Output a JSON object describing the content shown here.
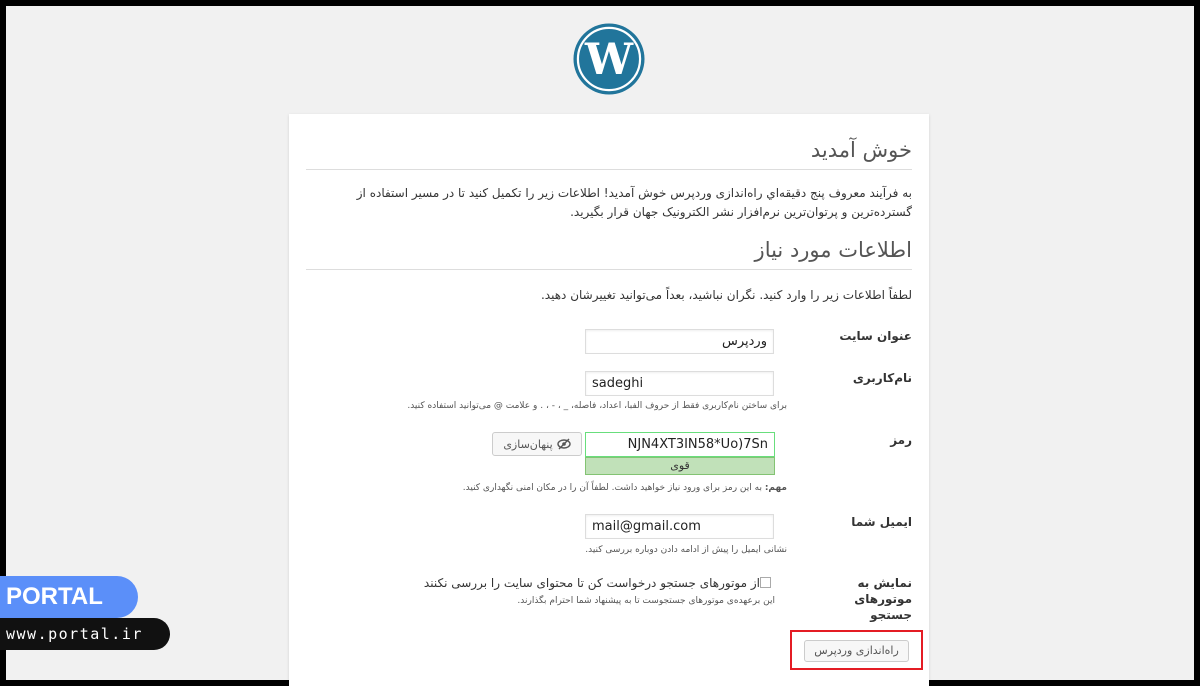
{
  "brand": {
    "logo_icon": "wordpress-logo-icon",
    "logo_color": "#21759b"
  },
  "welcome": {
    "title": "خوش آمدید",
    "intro": "به فرآیند معروف پنج دقیقه‌اي راه‌اندازی وردپرس خوش آمدید! اطلاعات زیر را تکمیل کنید تا در مسیر استفاده از گسترده‌ترین و پرتوان‌ترین نرم‌افزار نشر الکترونیک جهان قرار بگیرید."
  },
  "info": {
    "title": "اطلاعات مورد نیاز",
    "instructions": "لطفاً اطلاعات زیر را وارد کنید. نگران نباشید، بعداً می‌توانید تغییرشان دهید."
  },
  "form": {
    "site_title": {
      "label": "عنوان سایت",
      "value": "وردپرس"
    },
    "username": {
      "label": "نام‌کاربری",
      "value": "sadeghi",
      "hint": "برای ساختن نام‌کاربری فقط از حروف الفبا، اعداد، فاصله، _ ، - ، . و علامت @ می‌توانید استفاده کنید."
    },
    "password": {
      "label": "رمز",
      "value": "NJN4XT3IN58*Uo)7Sn",
      "strength": "قوی",
      "hide_label": "پنهان‌سازی",
      "hide_icon": "eye-slash-icon",
      "note_bold": "مهم:",
      "note": " به این رمز برای ورود نیاز خواهید داشت. لطفاً آن را در مکان امنی نگهداری کنید."
    },
    "email": {
      "label": "ایمیل شما",
      "value": "mail@gmail.com",
      "hint": "نشانی ایمیل را پیش از ادامه دادن دوباره بررسی کنید."
    },
    "search_visibility": {
      "label": "نمایش به موتورهای جستجو",
      "checkbox_label": "از موتورهای جستجو درخواست کن تا محتوای سایت را بررسی نکنند",
      "checked": false,
      "hint": "این برعهده‌ی موتورهای جستجوست تا به پیشنهاد شما احترام بگذارند."
    },
    "submit_label": "راه‌اندازی وردپرس"
  },
  "watermark": {
    "name": "PORTAL",
    "url": "www.portal.ir"
  },
  "colors": {
    "highlight_border": "#e41c24",
    "strength_bg": "#c1e1b9",
    "badge_blue": "#5b8ff9"
  }
}
